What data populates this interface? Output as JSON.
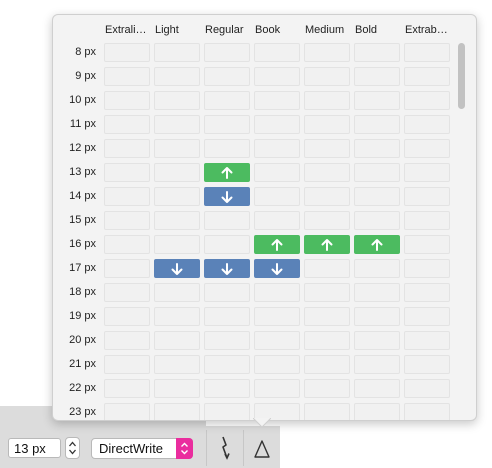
{
  "toolbar": {
    "size_value": "13 px",
    "engine": "DirectWrite",
    "engine_accent": "#ea2d9e",
    "tools": [
      {
        "icon": "lightning-icon"
      },
      {
        "icon": "delta-icon"
      }
    ],
    "delta_glyph": "Δ"
  },
  "grid": {
    "columns": [
      "Extrali…",
      "Light",
      "Regular",
      "Book",
      "Medium",
      "Bold",
      "Extrab…"
    ],
    "rows": [
      "8 px",
      "9 px",
      "10 px",
      "11 px",
      "12 px",
      "13 px",
      "14 px",
      "15 px",
      "16 px",
      "17 px",
      "18 px",
      "19 px",
      "20 px",
      "21 px",
      "22 px",
      "23 px"
    ],
    "colors": {
      "up": "#4cbb60",
      "down": "#5a82b8"
    },
    "changes": [
      {
        "row": "13 px",
        "column": "Regular",
        "direction": "up"
      },
      {
        "row": "14 px",
        "column": "Regular",
        "direction": "down"
      },
      {
        "row": "16 px",
        "column": "Book",
        "direction": "up"
      },
      {
        "row": "16 px",
        "column": "Medium",
        "direction": "up"
      },
      {
        "row": "16 px",
        "column": "Bold",
        "direction": "up"
      },
      {
        "row": "17 px",
        "column": "Light",
        "direction": "down"
      },
      {
        "row": "17 px",
        "column": "Regular",
        "direction": "down"
      },
      {
        "row": "17 px",
        "column": "Book",
        "direction": "down"
      }
    ]
  }
}
